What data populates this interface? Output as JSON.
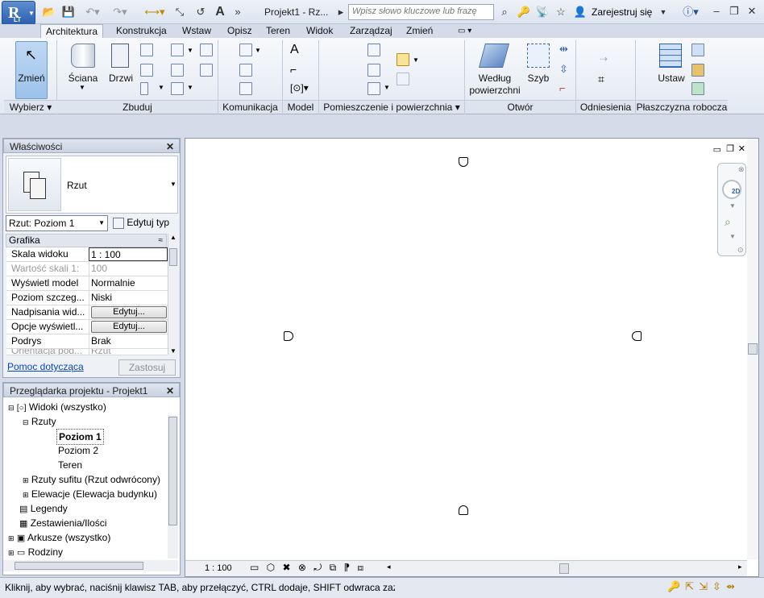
{
  "app": {
    "logo_letter": "R",
    "logo_sub": "LT",
    "title": "Projekt1 - Rz...",
    "search_placeholder": "Wpisz słowo kluczowe lub frazę",
    "register": "Zarejestruj się"
  },
  "tabs": [
    "Architektura",
    "Konstrukcja",
    "Wstaw",
    "Opisz",
    "Teren",
    "Widok",
    "Zarządzaj",
    "Zmień"
  ],
  "ribbon": {
    "buttons": {
      "zmien": "Zmień",
      "sciana": "Ściana",
      "drzwi": "Drzwi",
      "wedlug1": "Według",
      "wedlug2": "powierzchni",
      "szyb": "Szyb",
      "ustaw": "Ustaw"
    },
    "panels": [
      "Wybierz",
      "Zbuduj",
      "Komunikacja",
      "Model",
      "Pomieszczenie i powierzchnia",
      "Otwór",
      "Odniesienia",
      "Płaszczyzna robocza"
    ]
  },
  "properties": {
    "title": "Właściwości",
    "type_name": "Rzut",
    "view_select": "Rzut: Poziom 1",
    "edit_type": "Edytuj typ",
    "group": "Grafika",
    "rows": [
      {
        "k": "Skala widoku",
        "v": "1 : 100"
      },
      {
        "k": "Wartość skali   1:",
        "v": "100"
      },
      {
        "k": "Wyświetl model",
        "v": "Normalnie"
      },
      {
        "k": "Poziom szczeg...",
        "v": "Niski"
      },
      {
        "k": "Nadpisania wid...",
        "v": "Edytuj..."
      },
      {
        "k": "Opcje wyświetl...",
        "v": "Edytuj..."
      },
      {
        "k": "Podrys",
        "v": "Brak"
      },
      {
        "k": "Orientacja pod...",
        "v": "Rzut"
      }
    ],
    "help": "Pomoc dotycząca",
    "apply": "Zastosuj"
  },
  "browser": {
    "title": "Przeglądarka projektu - Projekt1",
    "items": [
      "Widoki (wszystko)",
      "Rzuty",
      "Poziom 1",
      "Poziom 2",
      "Teren",
      "Rzuty sufitu (Rzut odwrócony)",
      "Elewacje (Elewacja budynku)",
      "Legendy",
      "Zestawienia/Ilości",
      "Arkusze (wszystko)",
      "Rodziny"
    ]
  },
  "viewbar": {
    "scale": "1 : 100",
    "nav_2d": "2D"
  },
  "status": "Kliknij, aby wybrać, naciśnij klawisz TAB, aby przełączyć, CTRL dodaje, SHIFT odwraca zaznaczenie."
}
